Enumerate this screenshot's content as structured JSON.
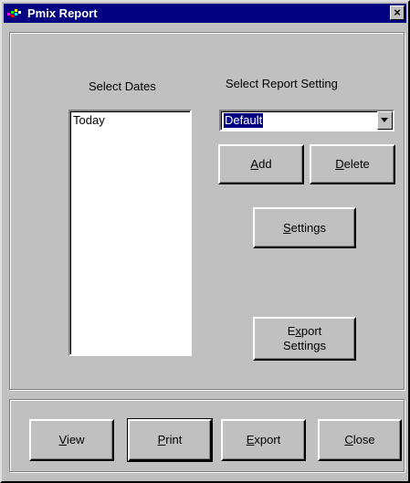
{
  "window": {
    "title": "Pmix Report",
    "close_glyph": "×"
  },
  "dates": {
    "label": "Select Dates",
    "items": [
      "Today"
    ]
  },
  "report_setting": {
    "label": "Select Report Setting",
    "selected": "Default",
    "add": "Add",
    "delete": "Delete",
    "settings": "Settings",
    "export_settings_line1": "Export",
    "export_settings_line2": "Settings"
  },
  "footer": {
    "view": "View",
    "print": "Print",
    "export": "Export",
    "close": "Close"
  },
  "icons": {
    "app": "pmix-app-icon",
    "dropdown": "chevron-down-icon",
    "close": "close-icon"
  },
  "colors": {
    "titlebar": "#000080",
    "face": "#c0c0c0",
    "selection": "#000080"
  }
}
